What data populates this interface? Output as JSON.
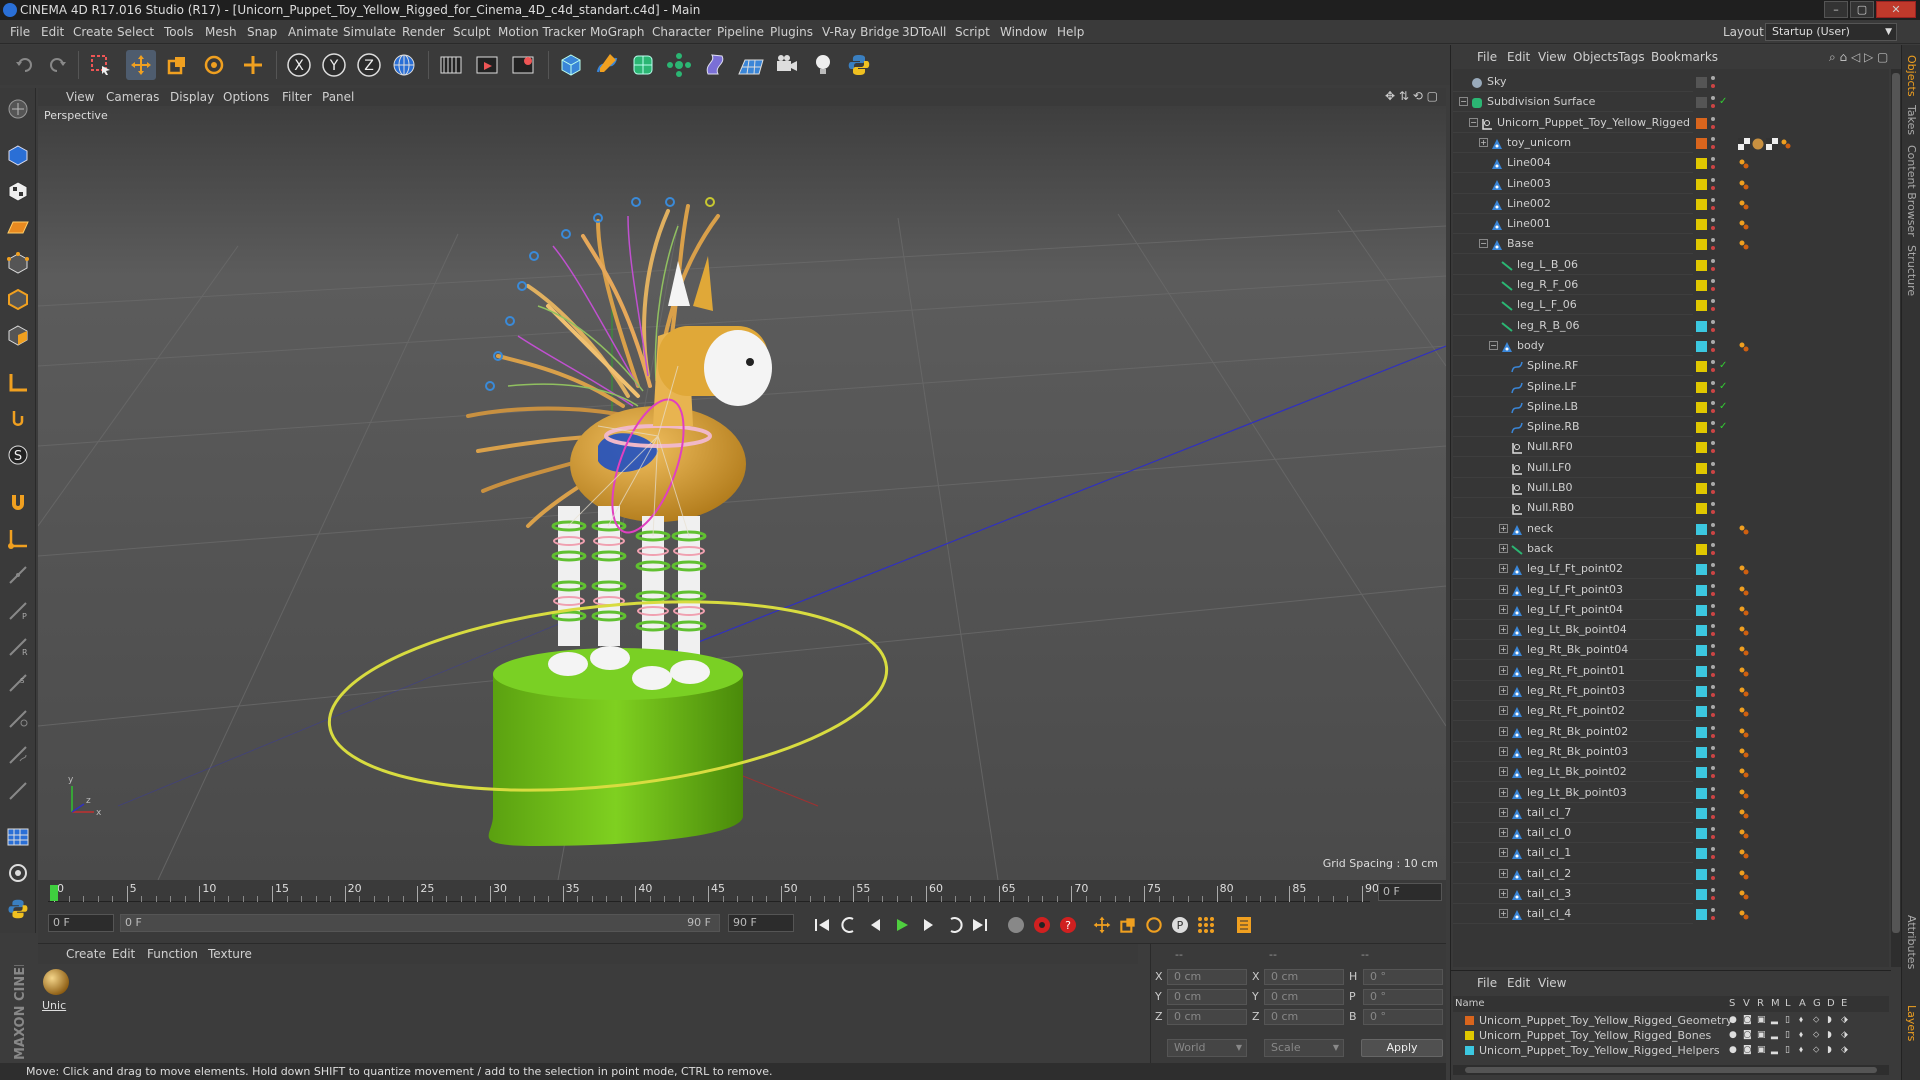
{
  "window": {
    "title": "CINEMA 4D R17.016 Studio (R17) - [Unicorn_Puppet_Toy_Yellow_Rigged_for_Cinema_4D_c4d_standart.c4d] - Main",
    "buttons": [
      "–",
      "▢",
      "✕"
    ]
  },
  "menubar": {
    "items": [
      "File",
      "Edit",
      "Create",
      "Select",
      "Tools",
      "Mesh",
      "Snap",
      "Animate",
      "Simulate",
      "Render",
      "Sculpt",
      "Motion Tracker",
      "MoGraph",
      "Character",
      "Pipeline",
      "Plugins",
      "V-Ray Bridge",
      "3DToAll",
      "Script",
      "Window",
      "Help"
    ],
    "layout_label": "Layout:",
    "layout_value": "Startup (User)"
  },
  "toolbar": {
    "icons": [
      "undo-icon",
      "redo-icon",
      "live-selection-icon",
      "move-icon",
      "scale-icon",
      "rotate-icon",
      "transform-icon",
      "x-axis-icon",
      "y-axis-icon",
      "z-axis-icon",
      "world-coordinates-icon",
      "render-view-icon",
      "render-picture-viewer-icon",
      "render-settings-icon",
      "cube-icon",
      "pen-icon",
      "subdivision-icon",
      "array-icon",
      "deformer-icon",
      "floor-icon",
      "camera-icon",
      "light-icon",
      "python-icon"
    ],
    "axis_letters": [
      "X",
      "Y",
      "Z"
    ]
  },
  "lefttoolbar": {
    "icons": [
      "make-editable-icon",
      "model-mode-icon",
      "texture-mode-icon",
      "workplane-icon",
      "points-mode-icon",
      "edges-mode-icon",
      "polygons-mode-icon",
      "axis-mode-icon",
      "tweak-icon",
      "soft-selection-icon",
      "magnet-icon",
      "joint-tool-icon",
      "ik-icon",
      "ik-pole-icon",
      "pose-icon",
      "weight-icon",
      "paint-icon",
      "hair-icon",
      "grid-snap-icon",
      "snap-settings-icon",
      "python-icon"
    ]
  },
  "viewport": {
    "menu": [
      "View",
      "Cameras",
      "Display",
      "Options",
      "Filter",
      "Panel"
    ],
    "label": "Perspective",
    "grid_spacing": "Grid Spacing : 10 cm",
    "axis": {
      "x": "x",
      "y": "y",
      "z": "z"
    }
  },
  "timeline": {
    "ticks": [
      "0",
      "5",
      "10",
      "15",
      "20",
      "25",
      "30",
      "35",
      "40",
      "45",
      "50",
      "55",
      "60",
      "65",
      "70",
      "75",
      "80",
      "85",
      "90"
    ],
    "current_frame": "0 F",
    "start_field": "0 F",
    "range_start": "0 F",
    "range_end": "90 F",
    "end_field": "90 F"
  },
  "material_manager": {
    "menu": [
      "Create",
      "Edit",
      "Function",
      "Texture"
    ],
    "material_name": "Unic"
  },
  "coordinates": {
    "header": [
      "--",
      "--",
      "--"
    ],
    "rows": [
      {
        "a": "X",
        "av": "0 cm",
        "b": "X",
        "bv": "0 cm",
        "c": "H",
        "cv": "0 °"
      },
      {
        "a": "Y",
        "av": "0 cm",
        "b": "Y",
        "bv": "0 cm",
        "c": "P",
        "cv": "0 °"
      },
      {
        "a": "Z",
        "av": "0 cm",
        "b": "Z",
        "bv": "0 cm",
        "c": "B",
        "cv": "0 °"
      }
    ],
    "mode1": "World",
    "mode2": "Scale",
    "apply": "Apply"
  },
  "status": "Move: Click and drag to move elements. Hold down SHIFT to quantize movement / add to the selection in point mode, CTRL to remove.",
  "branding": "MAXON CINEMA 4D",
  "object_manager": {
    "menu": [
      "File",
      "Edit",
      "View",
      "Objects",
      "Tags",
      "Bookmarks"
    ],
    "rows": [
      {
        "name": "Sky",
        "depth": 0,
        "exp": "",
        "icon": "sky",
        "color": "",
        "check": false,
        "tags": []
      },
      {
        "name": "Subdivision Surface",
        "depth": 0,
        "exp": "-",
        "icon": "subdiv",
        "color": "",
        "check": true,
        "tags": []
      },
      {
        "name": "Unicorn_Puppet_Toy_Yellow_Rigged",
        "depth": 1,
        "exp": "-",
        "icon": "null",
        "color": "#d9651d",
        "check": false,
        "tags": []
      },
      {
        "name": "toy_unicorn",
        "depth": 2,
        "exp": "+",
        "icon": "joint",
        "color": "#d9651d",
        "check": false,
        "tags": [
          "checker",
          "sphere",
          "checker",
          "weight"
        ]
      },
      {
        "name": "Line004",
        "depth": 2,
        "exp": "",
        "icon": "joint",
        "color": "#e0c800",
        "check": false,
        "tags": [
          "weight"
        ]
      },
      {
        "name": "Line003",
        "depth": 2,
        "exp": "",
        "icon": "joint",
        "color": "#e0c800",
        "check": false,
        "tags": [
          "weight"
        ]
      },
      {
        "name": "Line002",
        "depth": 2,
        "exp": "",
        "icon": "joint",
        "color": "#e0c800",
        "check": false,
        "tags": [
          "weight"
        ]
      },
      {
        "name": "Line001",
        "depth": 2,
        "exp": "",
        "icon": "joint",
        "color": "#e0c800",
        "check": false,
        "tags": [
          "weight"
        ]
      },
      {
        "name": "Base",
        "depth": 2,
        "exp": "-",
        "icon": "joint",
        "color": "#e0c800",
        "check": false,
        "tags": [
          "weight"
        ]
      },
      {
        "name": "leg_L_B_06",
        "depth": 3,
        "exp": "",
        "icon": "bone",
        "color": "#e0c800",
        "check": false,
        "tags": []
      },
      {
        "name": "leg_R_F_06",
        "depth": 3,
        "exp": "",
        "icon": "bone",
        "color": "#e0c800",
        "check": false,
        "tags": []
      },
      {
        "name": "leg_L_F_06",
        "depth": 3,
        "exp": "",
        "icon": "bone",
        "color": "#e0c800",
        "check": false,
        "tags": []
      },
      {
        "name": "leg_R_B_06",
        "depth": 3,
        "exp": "",
        "icon": "bone",
        "color": "#3cc8e0",
        "check": false,
        "tags": []
      },
      {
        "name": "body",
        "depth": 3,
        "exp": "-",
        "icon": "joint",
        "color": "#3cc8e0",
        "check": false,
        "tags": [
          "weight"
        ]
      },
      {
        "name": "Spline.RF",
        "depth": 4,
        "exp": "",
        "icon": "spline",
        "color": "#e0c800",
        "check": true,
        "tags": []
      },
      {
        "name": "Spline.LF",
        "depth": 4,
        "exp": "",
        "icon": "spline",
        "color": "#e0c800",
        "check": true,
        "tags": []
      },
      {
        "name": "Spline.LB",
        "depth": 4,
        "exp": "",
        "icon": "spline",
        "color": "#e0c800",
        "check": true,
        "tags": []
      },
      {
        "name": "Spline.RB",
        "depth": 4,
        "exp": "",
        "icon": "spline",
        "color": "#e0c800",
        "check": true,
        "tags": []
      },
      {
        "name": "Null.RF0",
        "depth": 4,
        "exp": "",
        "icon": "null",
        "color": "#e0c800",
        "check": false,
        "tags": []
      },
      {
        "name": "Null.LF0",
        "depth": 4,
        "exp": "",
        "icon": "null",
        "color": "#e0c800",
        "check": false,
        "tags": []
      },
      {
        "name": "Null.LB0",
        "depth": 4,
        "exp": "",
        "icon": "null",
        "color": "#e0c800",
        "check": false,
        "tags": []
      },
      {
        "name": "Null.RB0",
        "depth": 4,
        "exp": "",
        "icon": "null",
        "color": "#e0c800",
        "check": false,
        "tags": []
      },
      {
        "name": "neck",
        "depth": 4,
        "exp": "+",
        "icon": "joint",
        "color": "#3cc8e0",
        "check": false,
        "tags": [
          "weight"
        ]
      },
      {
        "name": "back",
        "depth": 4,
        "exp": "+",
        "icon": "bone",
        "color": "#e0c800",
        "check": false,
        "tags": []
      },
      {
        "name": "leg_Lf_Ft_point02",
        "depth": 4,
        "exp": "+",
        "icon": "joint",
        "color": "#3cc8e0",
        "check": false,
        "tags": [
          "weight"
        ]
      },
      {
        "name": "leg_Lf_Ft_point03",
        "depth": 4,
        "exp": "+",
        "icon": "joint",
        "color": "#3cc8e0",
        "check": false,
        "tags": [
          "weight"
        ]
      },
      {
        "name": "leg_Lf_Ft_point04",
        "depth": 4,
        "exp": "+",
        "icon": "joint",
        "color": "#3cc8e0",
        "check": false,
        "tags": [
          "weight"
        ]
      },
      {
        "name": "leg_Lt_Bk_point04",
        "depth": 4,
        "exp": "+",
        "icon": "joint",
        "color": "#3cc8e0",
        "check": false,
        "tags": [
          "weight"
        ]
      },
      {
        "name": "leg_Rt_Bk_point04",
        "depth": 4,
        "exp": "+",
        "icon": "joint",
        "color": "#3cc8e0",
        "check": false,
        "tags": [
          "weight"
        ]
      },
      {
        "name": "leg_Rt_Ft_point01",
        "depth": 4,
        "exp": "+",
        "icon": "joint",
        "color": "#3cc8e0",
        "check": false,
        "tags": [
          "weight"
        ]
      },
      {
        "name": "leg_Rt_Ft_point03",
        "depth": 4,
        "exp": "+",
        "icon": "joint",
        "color": "#3cc8e0",
        "check": false,
        "tags": [
          "weight"
        ]
      },
      {
        "name": "leg_Rt_Ft_point02",
        "depth": 4,
        "exp": "+",
        "icon": "joint",
        "color": "#3cc8e0",
        "check": false,
        "tags": [
          "weight"
        ]
      },
      {
        "name": "leg_Rt_Bk_point02",
        "depth": 4,
        "exp": "+",
        "icon": "joint",
        "color": "#3cc8e0",
        "check": false,
        "tags": [
          "weight"
        ]
      },
      {
        "name": "leg_Rt_Bk_point03",
        "depth": 4,
        "exp": "+",
        "icon": "joint",
        "color": "#3cc8e0",
        "check": false,
        "tags": [
          "weight"
        ]
      },
      {
        "name": "leg_Lt_Bk_point02",
        "depth": 4,
        "exp": "+",
        "icon": "joint",
        "color": "#3cc8e0",
        "check": false,
        "tags": [
          "weight"
        ]
      },
      {
        "name": "leg_Lt_Bk_point03",
        "depth": 4,
        "exp": "+",
        "icon": "joint",
        "color": "#3cc8e0",
        "check": false,
        "tags": [
          "weight"
        ]
      },
      {
        "name": "tail_cl_7",
        "depth": 4,
        "exp": "+",
        "icon": "joint",
        "color": "#3cc8e0",
        "check": false,
        "tags": [
          "weight"
        ]
      },
      {
        "name": "tail_cl_0",
        "depth": 4,
        "exp": "+",
        "icon": "joint",
        "color": "#3cc8e0",
        "check": false,
        "tags": [
          "weight"
        ]
      },
      {
        "name": "tail_cl_1",
        "depth": 4,
        "exp": "+",
        "icon": "joint",
        "color": "#3cc8e0",
        "check": false,
        "tags": [
          "weight"
        ]
      },
      {
        "name": "tail_cl_2",
        "depth": 4,
        "exp": "+",
        "icon": "joint",
        "color": "#3cc8e0",
        "check": false,
        "tags": [
          "weight"
        ]
      },
      {
        "name": "tail_cl_3",
        "depth": 4,
        "exp": "+",
        "icon": "joint",
        "color": "#3cc8e0",
        "check": false,
        "tags": [
          "weight"
        ]
      },
      {
        "name": "tail_cl_4",
        "depth": 4,
        "exp": "+",
        "icon": "joint",
        "color": "#3cc8e0",
        "check": false,
        "tags": [
          "weight"
        ]
      }
    ]
  },
  "side_tabs": [
    "Objects",
    "Takes",
    "Content Browser",
    "Structure",
    "Attributes",
    "Layers"
  ],
  "layer_manager": {
    "menu": [
      "File",
      "Edit",
      "View"
    ],
    "columns": [
      "Name",
      "S",
      "V",
      "R",
      "M",
      "L",
      "A",
      "G",
      "D",
      "E"
    ],
    "layers": [
      {
        "name": "Unicorn_Puppet_Toy_Yellow_Rigged_Geometry",
        "color": "#d9651d"
      },
      {
        "name": "Unicorn_Puppet_Toy_Yellow_Rigged_Bones",
        "color": "#e0c800"
      },
      {
        "name": "Unicorn_Puppet_Toy_Yellow_Rigged_Helpers",
        "color": "#3cc8e0"
      }
    ]
  },
  "colors": {
    "accent": "#4e5c6e",
    "selection": "#2a6fd6"
  }
}
